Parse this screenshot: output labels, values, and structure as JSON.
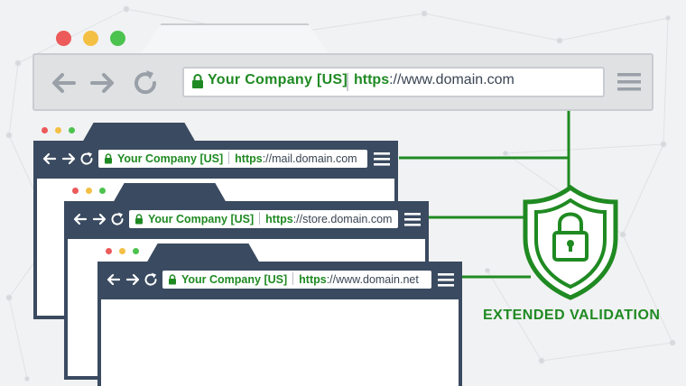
{
  "colors": {
    "accent_green": "#1f8a22",
    "dark_chrome": "#3a4a60",
    "light_chrome": "#dfe1e3",
    "dot_red": "#ec5a5a",
    "dot_yellow": "#f4c044",
    "dot_green": "#4cc34e"
  },
  "main_browser": {
    "company": "Your Company [US]",
    "url_scheme": "https",
    "url_rest": "://www.domain.com",
    "icons": [
      "back-arrow-icon",
      "forward-arrow-icon",
      "reload-icon",
      "padlock-icon",
      "hamburger-menu-icon"
    ]
  },
  "windows": [
    {
      "company": "Your Company [US]",
      "url_scheme": "https",
      "url_rest": "://mail.domain.com"
    },
    {
      "company": "Your Company [US]",
      "url_scheme": "https",
      "url_rest": "://store.domain.com"
    },
    {
      "company": "Your Company [US]",
      "url_scheme": "https",
      "url_rest": "://www.domain.net"
    }
  ],
  "badge": {
    "label": "EXTENDED VALIDATION",
    "icon": "shield-padlock-icon"
  }
}
